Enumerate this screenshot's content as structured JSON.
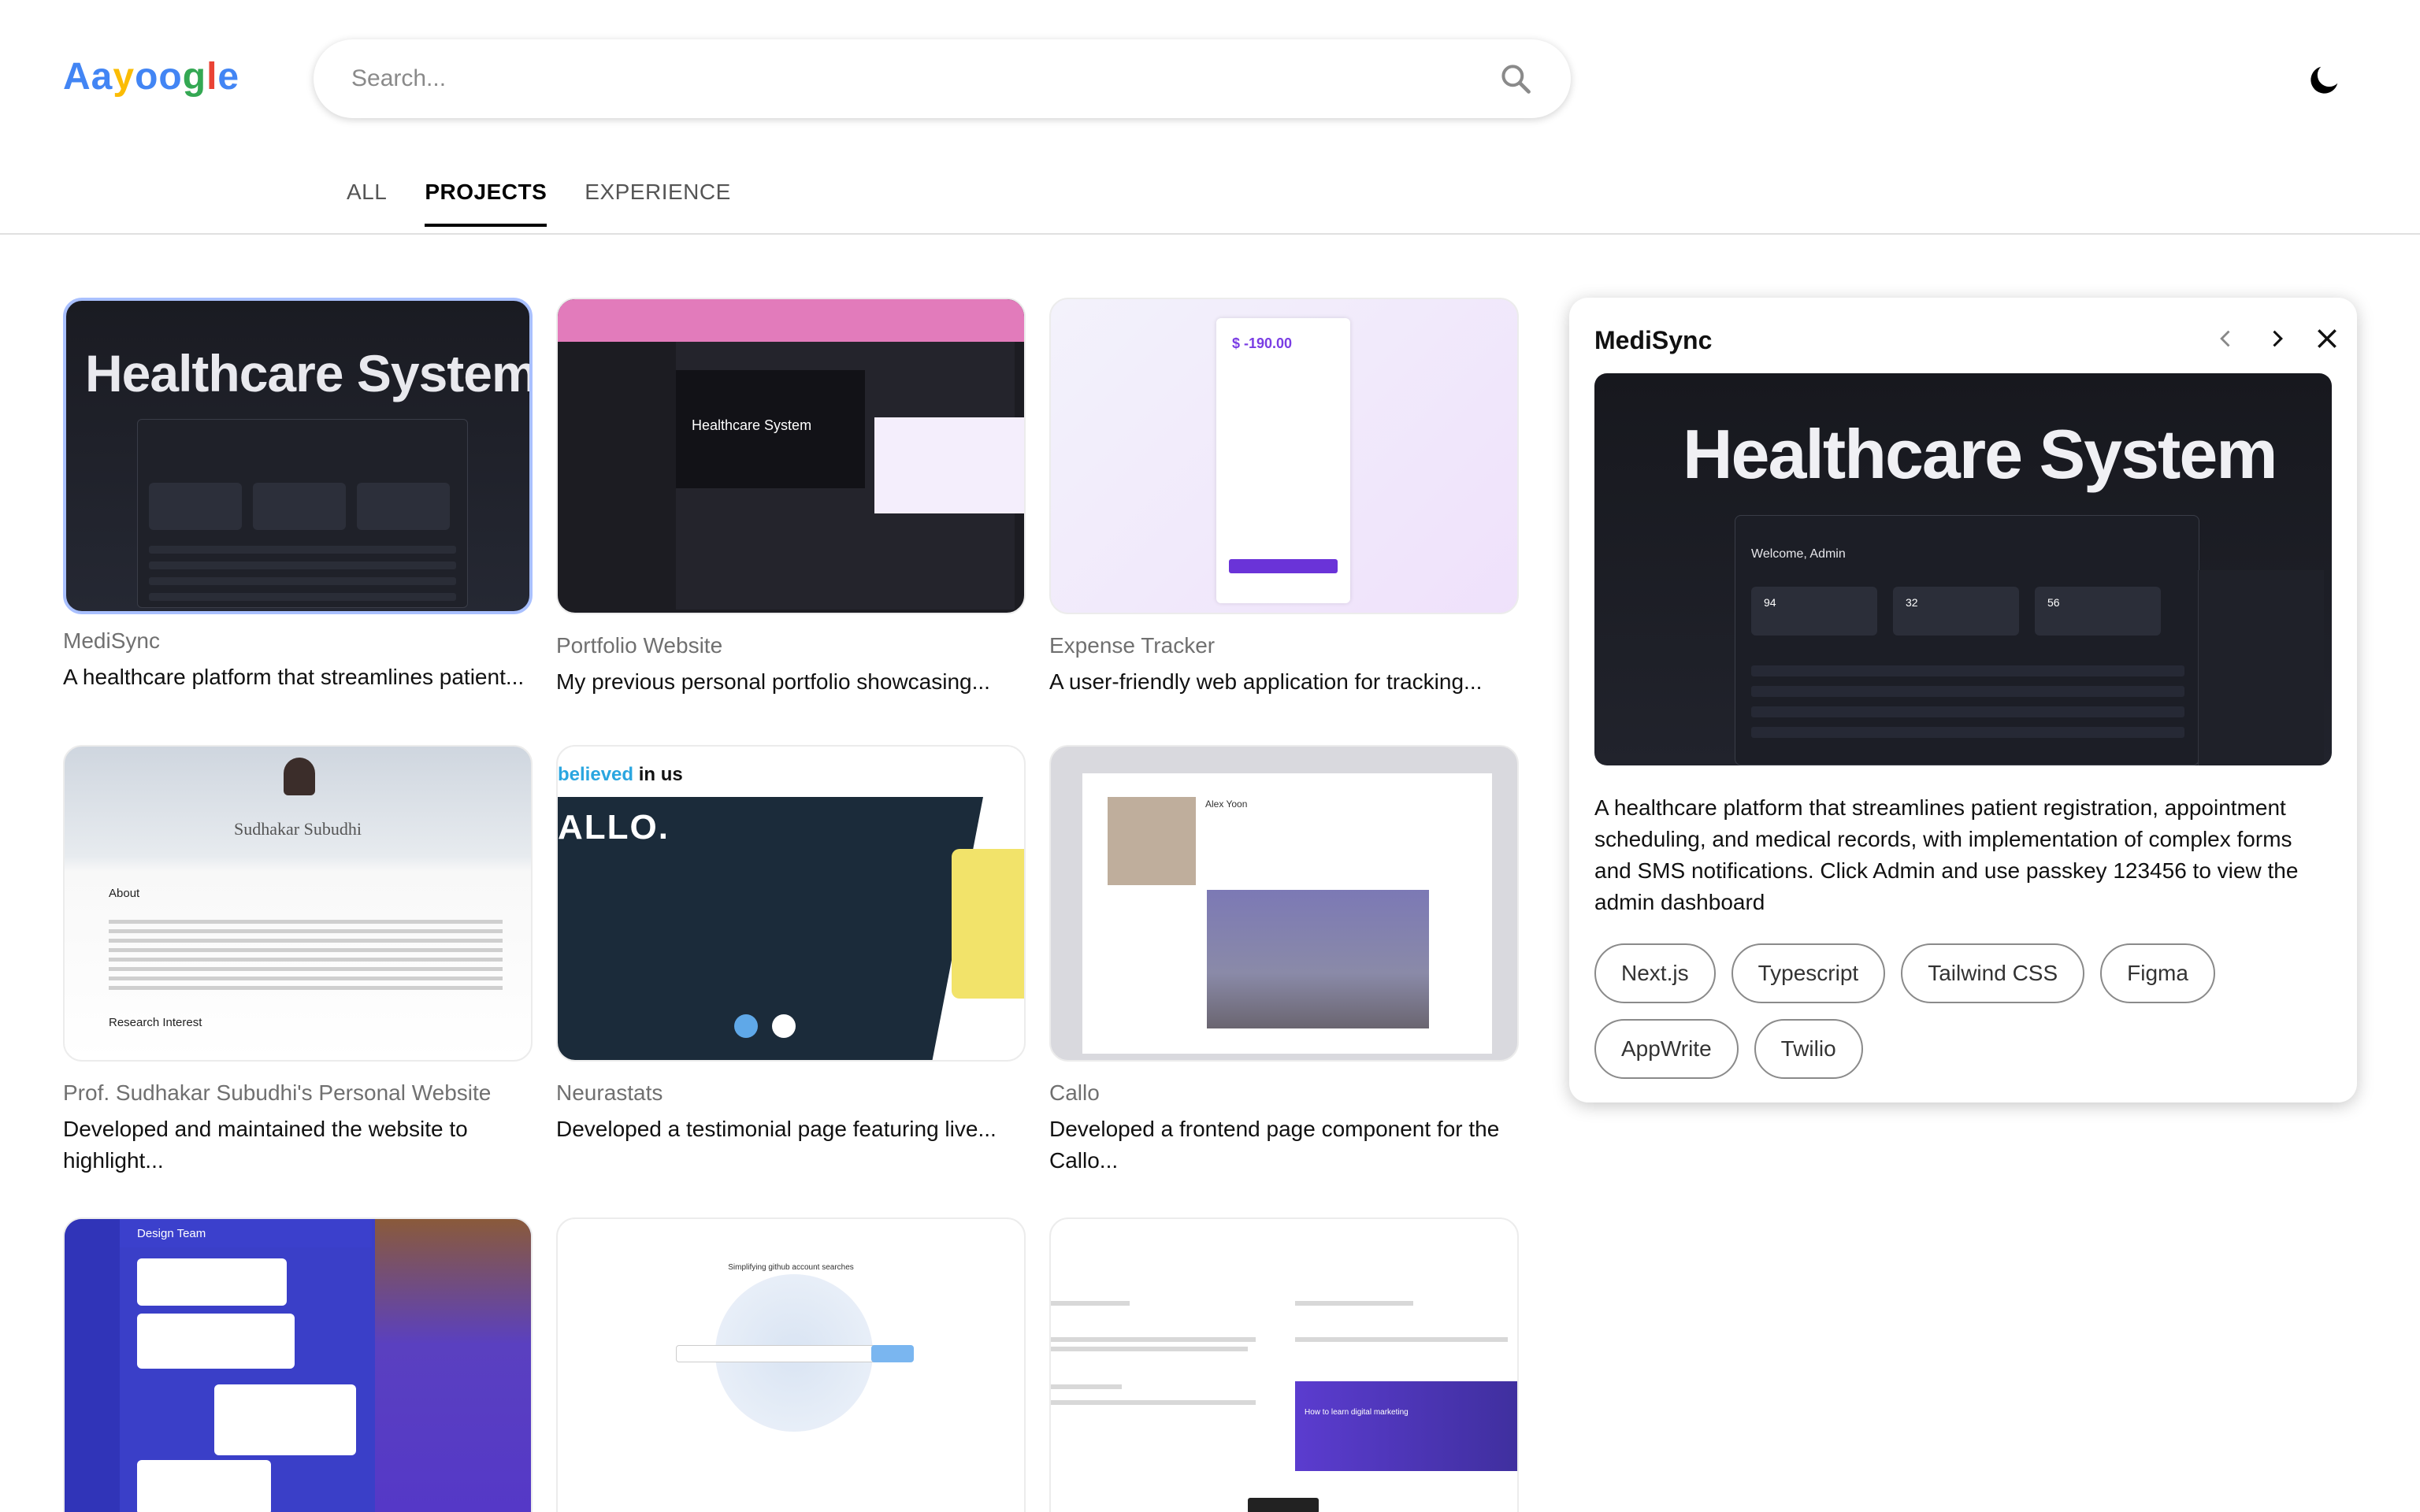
{
  "header": {
    "logo": "Aayoogle",
    "logo_colors": [
      "#4285F4",
      "#4285F4",
      "#FBBC05",
      "#4285F4",
      "#4285F4",
      "#34A853",
      "#EA4335",
      "#4285F4"
    ],
    "search_placeholder": "Search...",
    "search_icon": "search-icon",
    "theme_icon": "moon-icon"
  },
  "tabs": [
    {
      "label": "ALL"
    },
    {
      "label": "PROJECTS"
    },
    {
      "label": "EXPERIENCE"
    }
  ],
  "active_tab": "PROJECTS",
  "projects": [
    {
      "title": "MediSync",
      "desc": "A healthcare platform that streamlines patient...",
      "thumb_text": "Healthcare System"
    },
    {
      "title": "Portfolio Website",
      "desc": "My previous personal portfolio showcasing...",
      "thumb_text": "Healthcare System"
    },
    {
      "title": "Expense Tracker",
      "desc": "A user-friendly web application for tracking...",
      "thumb_text": "$ -190.00"
    },
    {
      "title": "Prof. Sudhakar Subudhi's Personal Website",
      "desc": "Developed and maintained the website to highlight...",
      "thumb_text": "Sudhakar Subudhi"
    },
    {
      "title": "Neurastats",
      "desc": "Developed a testimonial page featuring live...",
      "thumb_text": "ALLO."
    },
    {
      "title": "Callo",
      "desc": "Developed a frontend page component for the Callo...",
      "thumb_text": "Alex Yoon"
    },
    {
      "title": "",
      "desc": "",
      "thumb_text": "Design Team"
    },
    {
      "title": "",
      "desc": "",
      "thumb_text": "Simplifying github account searches"
    },
    {
      "title": "",
      "desc": "",
      "thumb_text": "How to learn digital marketing"
    }
  ],
  "detail": {
    "title": "MediSync",
    "image_text": "Healthcare System",
    "image_subtext": "Welcome, Admin",
    "stats": [
      "94",
      "32",
      "56"
    ],
    "description": "A healthcare platform that streamlines patient registration, appointment scheduling, and medical records, with implementation of complex forms and SMS notifications. Click Admin and use passkey 123456 to view the admin dashboard",
    "tags": [
      "Next.js",
      "Typescript",
      "Tailwind CSS",
      "Figma",
      "AppWrite",
      "Twilio"
    ],
    "prev_icon": "chevron-left-icon",
    "next_icon": "chevron-right-icon",
    "close_icon": "close-icon"
  }
}
